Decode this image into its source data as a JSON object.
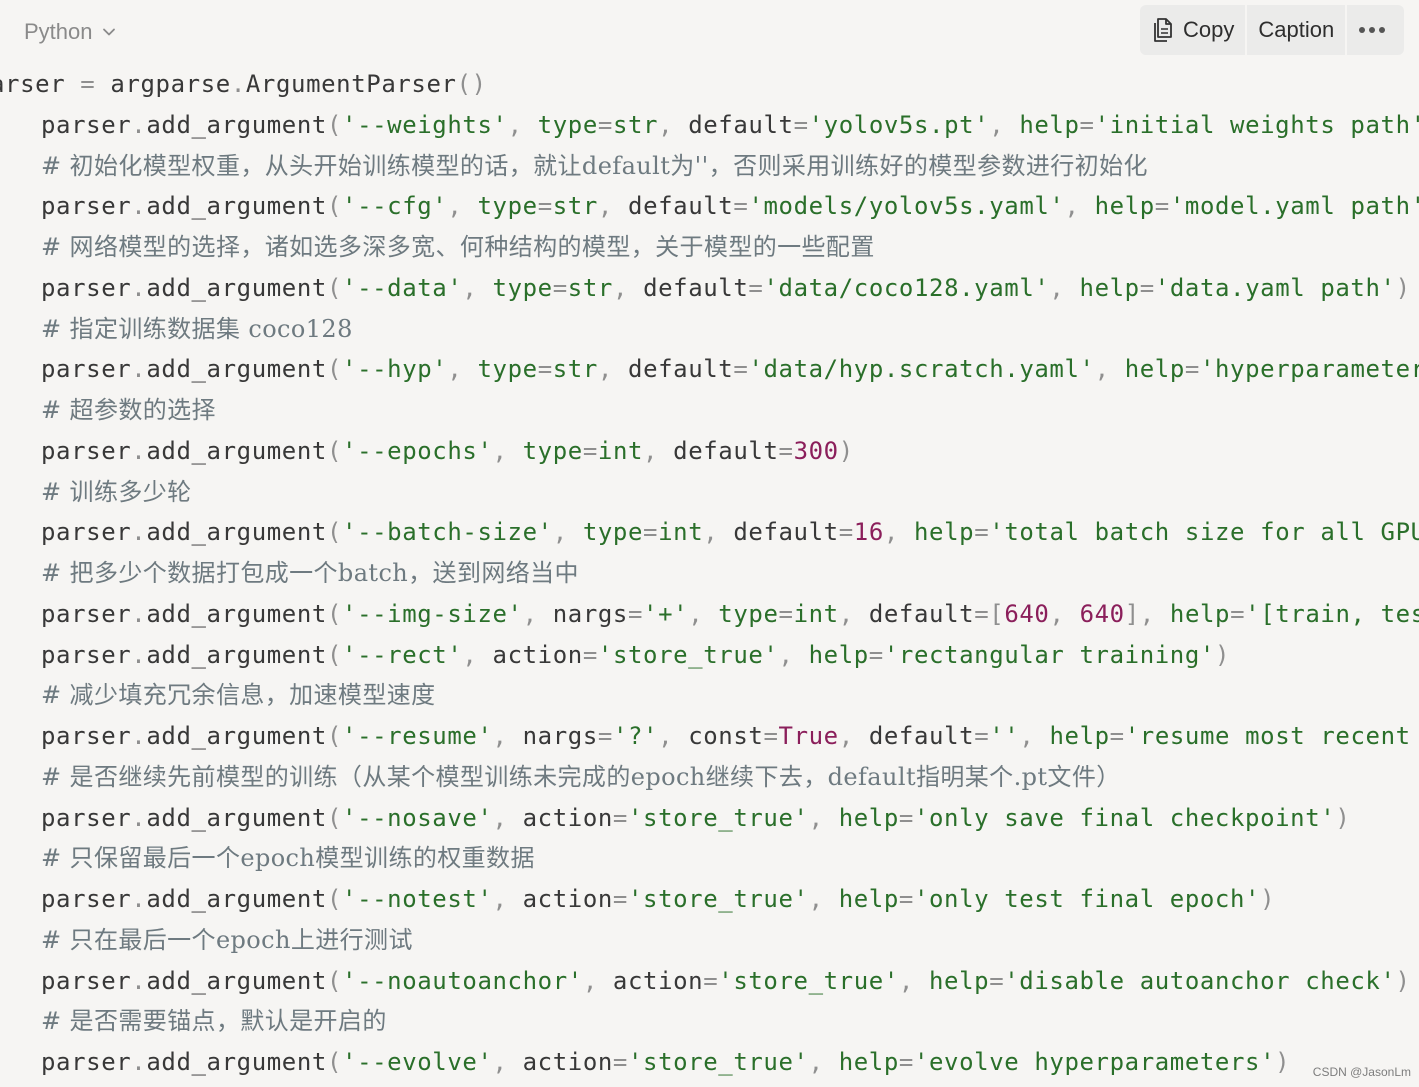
{
  "header": {
    "language": "Python",
    "copy_label": "Copy",
    "caption_label": "Caption",
    "more_label": "•••"
  },
  "code_lines": [
    {
      "kind": "first",
      "tokens": [
        [
          "plain",
          "arser "
        ],
        [
          "op",
          "="
        ],
        [
          "plain",
          " argparse"
        ],
        [
          "punc",
          "."
        ],
        [
          "plain",
          "ArgumentParser"
        ],
        [
          "punc",
          "()"
        ]
      ]
    },
    {
      "kind": "code",
      "tokens": [
        [
          "plain",
          "parser"
        ],
        [
          "punc",
          "."
        ],
        [
          "plain",
          "add_argument"
        ],
        [
          "punc",
          "("
        ],
        [
          "str",
          "'--weights'"
        ],
        [
          "punc",
          ", "
        ],
        [
          "kw",
          "type"
        ],
        [
          "op",
          "="
        ],
        [
          "kw",
          "str"
        ],
        [
          "punc",
          ", "
        ],
        [
          "plain",
          "default"
        ],
        [
          "op",
          "="
        ],
        [
          "str",
          "'yolov5s.pt'"
        ],
        [
          "punc",
          ", "
        ],
        [
          "kw",
          "help"
        ],
        [
          "op",
          "="
        ],
        [
          "str",
          "'initial weights path'"
        ]
      ]
    },
    {
      "kind": "comment",
      "text": "# 初始化模型权重，从头开始训练模型的话，就让default为''，否则采用训练好的模型参数进行初始化"
    },
    {
      "kind": "code",
      "tokens": [
        [
          "plain",
          "parser"
        ],
        [
          "punc",
          "."
        ],
        [
          "plain",
          "add_argument"
        ],
        [
          "punc",
          "("
        ],
        [
          "str",
          "'--cfg'"
        ],
        [
          "punc",
          ", "
        ],
        [
          "kw",
          "type"
        ],
        [
          "op",
          "="
        ],
        [
          "kw",
          "str"
        ],
        [
          "punc",
          ", "
        ],
        [
          "plain",
          "default"
        ],
        [
          "op",
          "="
        ],
        [
          "str",
          "'models/yolov5s.yaml'"
        ],
        [
          "punc",
          ", "
        ],
        [
          "kw",
          "help"
        ],
        [
          "op",
          "="
        ],
        [
          "str",
          "'model.yaml path'"
        ]
      ]
    },
    {
      "kind": "comment",
      "text": "# 网络模型的选择，诸如选多深多宽、何种结构的模型，关于模型的一些配置"
    },
    {
      "kind": "code",
      "tokens": [
        [
          "plain",
          "parser"
        ],
        [
          "punc",
          "."
        ],
        [
          "plain",
          "add_argument"
        ],
        [
          "punc",
          "("
        ],
        [
          "str",
          "'--data'"
        ],
        [
          "punc",
          ", "
        ],
        [
          "kw",
          "type"
        ],
        [
          "op",
          "="
        ],
        [
          "kw",
          "str"
        ],
        [
          "punc",
          ", "
        ],
        [
          "plain",
          "default"
        ],
        [
          "op",
          "="
        ],
        [
          "str",
          "'data/coco128.yaml'"
        ],
        [
          "punc",
          ", "
        ],
        [
          "kw",
          "help"
        ],
        [
          "op",
          "="
        ],
        [
          "str",
          "'data.yaml path'"
        ],
        [
          "punc",
          ")"
        ]
      ]
    },
    {
      "kind": "comment",
      "text": "# 指定训练数据集 coco128"
    },
    {
      "kind": "code",
      "tokens": [
        [
          "plain",
          "parser"
        ],
        [
          "punc",
          "."
        ],
        [
          "plain",
          "add_argument"
        ],
        [
          "punc",
          "("
        ],
        [
          "str",
          "'--hyp'"
        ],
        [
          "punc",
          ", "
        ],
        [
          "kw",
          "type"
        ],
        [
          "op",
          "="
        ],
        [
          "kw",
          "str"
        ],
        [
          "punc",
          ", "
        ],
        [
          "plain",
          "default"
        ],
        [
          "op",
          "="
        ],
        [
          "str",
          "'data/hyp.scratch.yaml'"
        ],
        [
          "punc",
          ", "
        ],
        [
          "kw",
          "help"
        ],
        [
          "op",
          "="
        ],
        [
          "str",
          "'hyperparameter"
        ]
      ]
    },
    {
      "kind": "comment",
      "text": "# 超参数的选择"
    },
    {
      "kind": "code",
      "tokens": [
        [
          "plain",
          "parser"
        ],
        [
          "punc",
          "."
        ],
        [
          "plain",
          "add_argument"
        ],
        [
          "punc",
          "("
        ],
        [
          "str",
          "'--epochs'"
        ],
        [
          "punc",
          ", "
        ],
        [
          "kw",
          "type"
        ],
        [
          "op",
          "="
        ],
        [
          "kw",
          "int"
        ],
        [
          "punc",
          ", "
        ],
        [
          "plain",
          "default"
        ],
        [
          "op",
          "="
        ],
        [
          "num",
          "300"
        ],
        [
          "punc",
          ")"
        ]
      ]
    },
    {
      "kind": "comment",
      "text": "# 训练多少轮"
    },
    {
      "kind": "code",
      "tokens": [
        [
          "plain",
          "parser"
        ],
        [
          "punc",
          "."
        ],
        [
          "plain",
          "add_argument"
        ],
        [
          "punc",
          "("
        ],
        [
          "str",
          "'--batch-size'"
        ],
        [
          "punc",
          ", "
        ],
        [
          "kw",
          "type"
        ],
        [
          "op",
          "="
        ],
        [
          "kw",
          "int"
        ],
        [
          "punc",
          ", "
        ],
        [
          "plain",
          "default"
        ],
        [
          "op",
          "="
        ],
        [
          "num",
          "16"
        ],
        [
          "punc",
          ", "
        ],
        [
          "kw",
          "help"
        ],
        [
          "op",
          "="
        ],
        [
          "str",
          "'total batch size for all GPU"
        ]
      ]
    },
    {
      "kind": "comment",
      "text": "# 把多少个数据打包成一个batch，送到网络当中"
    },
    {
      "kind": "code",
      "tokens": [
        [
          "plain",
          "parser"
        ],
        [
          "punc",
          "."
        ],
        [
          "plain",
          "add_argument"
        ],
        [
          "punc",
          "("
        ],
        [
          "str",
          "'--img-size'"
        ],
        [
          "punc",
          ", "
        ],
        [
          "plain",
          "nargs"
        ],
        [
          "op",
          "="
        ],
        [
          "str",
          "'+'"
        ],
        [
          "punc",
          ", "
        ],
        [
          "kw",
          "type"
        ],
        [
          "op",
          "="
        ],
        [
          "kw",
          "int"
        ],
        [
          "punc",
          ", "
        ],
        [
          "plain",
          "default"
        ],
        [
          "op",
          "="
        ],
        [
          "punc",
          "["
        ],
        [
          "num",
          "640"
        ],
        [
          "punc",
          ", "
        ],
        [
          "num",
          "640"
        ],
        [
          "punc",
          "]"
        ],
        [
          "punc",
          ", "
        ],
        [
          "kw",
          "help"
        ],
        [
          "op",
          "="
        ],
        [
          "str",
          "'[train, tes"
        ]
      ]
    },
    {
      "kind": "code",
      "tokens": [
        [
          "plain",
          "parser"
        ],
        [
          "punc",
          "."
        ],
        [
          "plain",
          "add_argument"
        ],
        [
          "punc",
          "("
        ],
        [
          "str",
          "'--rect'"
        ],
        [
          "punc",
          ", "
        ],
        [
          "plain",
          "action"
        ],
        [
          "op",
          "="
        ],
        [
          "str",
          "'store_true'"
        ],
        [
          "punc",
          ", "
        ],
        [
          "kw",
          "help"
        ],
        [
          "op",
          "="
        ],
        [
          "str",
          "'rectangular training'"
        ],
        [
          "punc",
          ")"
        ]
      ]
    },
    {
      "kind": "comment",
      "text": "# 减少填充冗余信息，加速模型速度"
    },
    {
      "kind": "code",
      "tokens": [
        [
          "plain",
          "parser"
        ],
        [
          "punc",
          "."
        ],
        [
          "plain",
          "add_argument"
        ],
        [
          "punc",
          "("
        ],
        [
          "str",
          "'--resume'"
        ],
        [
          "punc",
          ", "
        ],
        [
          "plain",
          "nargs"
        ],
        [
          "op",
          "="
        ],
        [
          "str",
          "'?'"
        ],
        [
          "punc",
          ", "
        ],
        [
          "plain",
          "const"
        ],
        [
          "op",
          "="
        ],
        [
          "bool",
          "True"
        ],
        [
          "punc",
          ", "
        ],
        [
          "plain",
          "default"
        ],
        [
          "op",
          "="
        ],
        [
          "str",
          "''"
        ],
        [
          "punc",
          ", "
        ],
        [
          "kw",
          "help"
        ],
        [
          "op",
          "="
        ],
        [
          "str",
          "'resume most recent"
        ]
      ]
    },
    {
      "kind": "comment",
      "text": "# 是否继续先前模型的训练（从某个模型训练未完成的epoch继续下去，default指明某个.pt文件）"
    },
    {
      "kind": "code",
      "tokens": [
        [
          "plain",
          "parser"
        ],
        [
          "punc",
          "."
        ],
        [
          "plain",
          "add_argument"
        ],
        [
          "punc",
          "("
        ],
        [
          "str",
          "'--nosave'"
        ],
        [
          "punc",
          ", "
        ],
        [
          "plain",
          "action"
        ],
        [
          "op",
          "="
        ],
        [
          "str",
          "'store_true'"
        ],
        [
          "punc",
          ", "
        ],
        [
          "kw",
          "help"
        ],
        [
          "op",
          "="
        ],
        [
          "str",
          "'only save final checkpoint'"
        ],
        [
          "punc",
          ")"
        ]
      ]
    },
    {
      "kind": "comment",
      "text": "# 只保留最后一个epoch模型训练的权重数据"
    },
    {
      "kind": "code",
      "tokens": [
        [
          "plain",
          "parser"
        ],
        [
          "punc",
          "."
        ],
        [
          "plain",
          "add_argument"
        ],
        [
          "punc",
          "("
        ],
        [
          "str",
          "'--notest'"
        ],
        [
          "punc",
          ", "
        ],
        [
          "plain",
          "action"
        ],
        [
          "op",
          "="
        ],
        [
          "str",
          "'store_true'"
        ],
        [
          "punc",
          ", "
        ],
        [
          "kw",
          "help"
        ],
        [
          "op",
          "="
        ],
        [
          "str",
          "'only test final epoch'"
        ],
        [
          "punc",
          ")"
        ]
      ]
    },
    {
      "kind": "comment",
      "text": "# 只在最后一个epoch上进行测试"
    },
    {
      "kind": "code",
      "tokens": [
        [
          "plain",
          "parser"
        ],
        [
          "punc",
          "."
        ],
        [
          "plain",
          "add_argument"
        ],
        [
          "punc",
          "("
        ],
        [
          "str",
          "'--noautoanchor'"
        ],
        [
          "punc",
          ", "
        ],
        [
          "plain",
          "action"
        ],
        [
          "op",
          "="
        ],
        [
          "str",
          "'store_true'"
        ],
        [
          "punc",
          ", "
        ],
        [
          "kw",
          "help"
        ],
        [
          "op",
          "="
        ],
        [
          "str",
          "'disable autoanchor check'"
        ],
        [
          "punc",
          ")"
        ]
      ]
    },
    {
      "kind": "comment",
      "text": "# 是否需要锚点，默认是开启的"
    },
    {
      "kind": "code",
      "tokens": [
        [
          "plain",
          "parser"
        ],
        [
          "punc",
          "."
        ],
        [
          "plain",
          "add_argument"
        ],
        [
          "punc",
          "("
        ],
        [
          "str",
          "'--evolve'"
        ],
        [
          "punc",
          ", "
        ],
        [
          "plain",
          "action"
        ],
        [
          "op",
          "="
        ],
        [
          "str",
          "'store_true'"
        ],
        [
          "punc",
          ", "
        ],
        [
          "kw",
          "help"
        ],
        [
          "op",
          "="
        ],
        [
          "str",
          "'evolve hyperparameters'"
        ],
        [
          "punc",
          ")"
        ]
      ]
    }
  ],
  "watermark": "CSDN @JasonLm",
  "colors": {
    "background": "#f6f5f3",
    "string": "#2a6f2a",
    "number": "#8b1f5b",
    "comment": "#6e7a80",
    "punctuation": "#8f8f8f"
  },
  "icons": [
    "chevron-down-icon",
    "copy-icon",
    "more-icon"
  ]
}
